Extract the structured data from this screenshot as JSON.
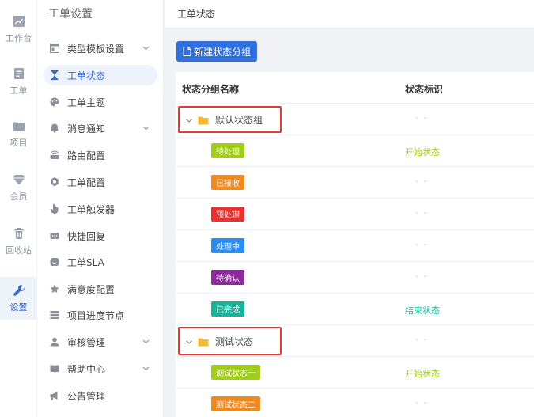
{
  "rail": [
    {
      "label": "工作台",
      "icon": "chart-icon"
    },
    {
      "label": "工单",
      "icon": "ticket-icon"
    },
    {
      "label": "项目",
      "icon": "folder-icon"
    },
    {
      "label": "会员",
      "icon": "diamond-icon"
    },
    {
      "label": "回收站",
      "icon": "trash-icon"
    },
    {
      "label": "设置",
      "icon": "wrench-icon"
    }
  ],
  "submenu": {
    "title": "工单设置",
    "items": [
      {
        "label": "类型模板设置",
        "icon": "template-icon"
      },
      {
        "label": "工单状态",
        "icon": "hourglass-icon"
      },
      {
        "label": "工单主题",
        "icon": "palette-icon"
      },
      {
        "label": "消息通知",
        "icon": "bell-icon"
      },
      {
        "label": "路由配置",
        "icon": "router-icon"
      },
      {
        "label": "工单配置",
        "icon": "gear-icon"
      },
      {
        "label": "工单触发器",
        "icon": "hand-icon"
      },
      {
        "label": "快捷回复",
        "icon": "reply-icon"
      },
      {
        "label": "工单SLA",
        "icon": "sla-icon"
      },
      {
        "label": "满意度配置",
        "icon": "star-icon"
      },
      {
        "label": "项目进度节点",
        "icon": "list-icon"
      },
      {
        "label": "审核管理",
        "icon": "user-icon"
      },
      {
        "label": "帮助中心",
        "icon": "book-icon"
      },
      {
        "label": "公告管理",
        "icon": "megaphone-icon"
      }
    ]
  },
  "header": {
    "title": "工单状态"
  },
  "toolbar": {
    "new_group_label": "新建状态分组"
  },
  "table": {
    "columns": [
      "状态分组名称",
      "状态标识"
    ],
    "empty_mark": "- -",
    "rows": [
      {
        "type": "group",
        "name": "默认状态组",
        "mark": ""
      },
      {
        "type": "status",
        "name": "待处理",
        "color": "#a0cd1a",
        "mark": "开始状态",
        "mark_color": "#a0cd1a"
      },
      {
        "type": "status",
        "name": "已接收",
        "color": "#f08a1c",
        "mark": ""
      },
      {
        "type": "status",
        "name": "预处理",
        "color": "#e8322f",
        "mark": ""
      },
      {
        "type": "status",
        "name": "处理中",
        "color": "#2d8cf0",
        "mark": ""
      },
      {
        "type": "status",
        "name": "待确认",
        "color": "#8f2a9c",
        "mark": ""
      },
      {
        "type": "status",
        "name": "已完成",
        "color": "#19b39a",
        "mark": "结束状态",
        "mark_color": "#19b39a"
      },
      {
        "type": "group",
        "name": "测试状态",
        "mark": ""
      },
      {
        "type": "status",
        "name": "测试状态一",
        "color": "#a0cd1a",
        "mark": "开始状态",
        "mark_color": "#a0cd1a"
      },
      {
        "type": "status",
        "name": "测试状态二",
        "color": "#f08a1c",
        "mark": ""
      }
    ]
  }
}
